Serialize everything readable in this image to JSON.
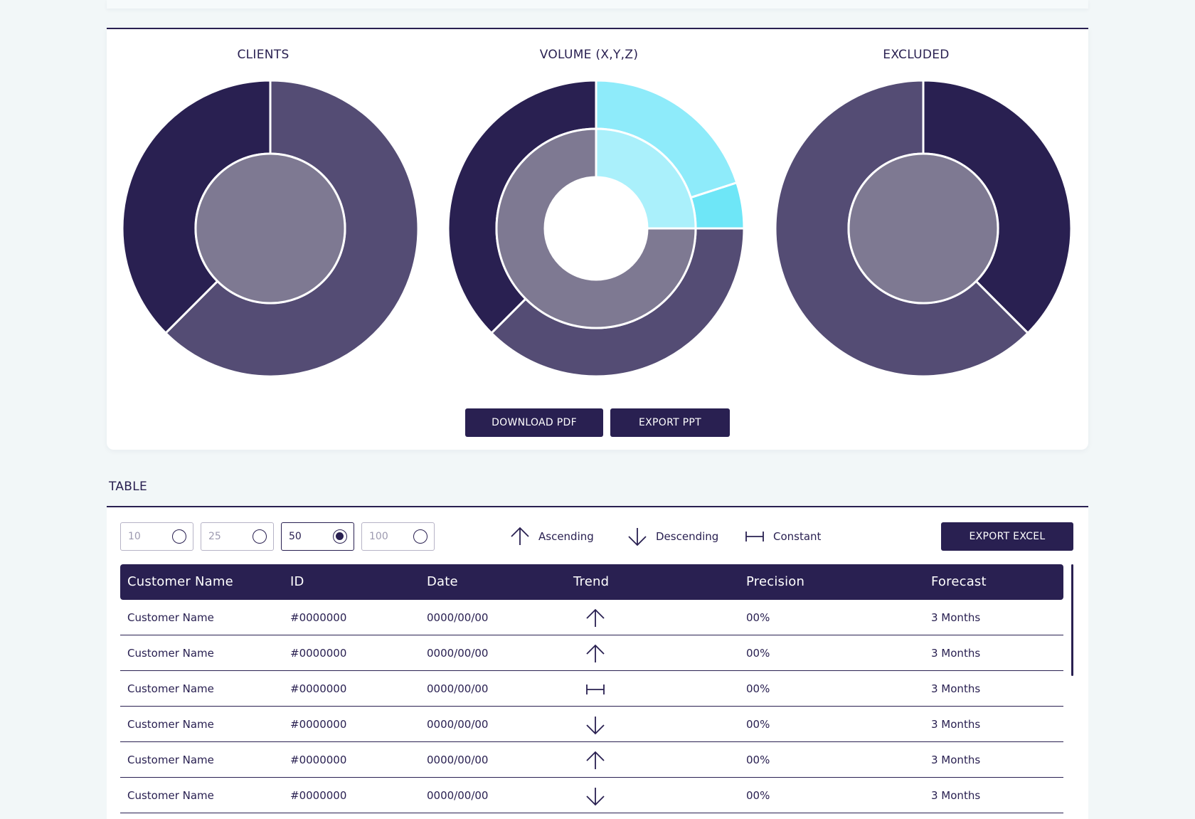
{
  "colors": {
    "navy": "#292051",
    "slate": "#544c74",
    "grey_violet": "#7e7992",
    "cyan_outer": "#8eebfa",
    "cyan_inner": "#aaf0fb",
    "cyan_bright": "#6ee6f7",
    "white": "#ffffff"
  },
  "charts": {
    "title_clients": "CLIENTS",
    "title_volume": "VOLUME (X,Y,Z)",
    "title_excluded": "EXCLUDED"
  },
  "chart_data": [
    {
      "type": "pie",
      "title": "CLIENTS",
      "rings": [
        {
          "ring": "outer",
          "slices": [
            {
              "value": 62.5,
              "color": "#544c74"
            },
            {
              "value": 37.5,
              "color": "#292051"
            }
          ]
        },
        {
          "ring": "inner",
          "slices": [
            {
              "value": 100,
              "color": "#7e7992"
            }
          ]
        }
      ]
    },
    {
      "type": "pie",
      "title": "VOLUME (X,Y,Z)",
      "rings": [
        {
          "ring": "outer",
          "slices": [
            {
              "value": 20,
              "color": "#8eebfa"
            },
            {
              "value": 5,
              "color": "#6ee6f7"
            },
            {
              "value": 37.5,
              "color": "#544c74"
            },
            {
              "value": 37.5,
              "color": "#292051"
            }
          ]
        },
        {
          "ring": "inner",
          "slices": [
            {
              "value": 25,
              "color": "#aaf0fb"
            },
            {
              "value": 75,
              "color": "#7e7992"
            }
          ]
        }
      ]
    },
    {
      "type": "pie",
      "title": "EXCLUDED",
      "rings": [
        {
          "ring": "outer",
          "slices": [
            {
              "value": 37.5,
              "color": "#292051"
            },
            {
              "value": 62.5,
              "color": "#544c74"
            }
          ]
        },
        {
          "ring": "inner",
          "slices": [
            {
              "value": 100,
              "color": "#7e7992"
            }
          ]
        }
      ]
    }
  ],
  "buttons": {
    "download_pdf": "DOWNLOAD PDF",
    "export_ppt": "EXPORT PPT",
    "export_excel": "EXPORT EXCEL"
  },
  "table": {
    "label": "TABLE",
    "page_sizes": [
      "10",
      "25",
      "50",
      "100"
    ],
    "selected_page_size": "50",
    "legend": {
      "ascending": "Ascending",
      "descending": "Descending",
      "constant": "Constant"
    },
    "headers": [
      "Customer Name",
      "ID",
      "Date",
      "Trend",
      "Precision",
      "Forecast"
    ],
    "rows": [
      {
        "name": "Customer Name",
        "id": "#0000000",
        "date": "0000/00/00",
        "trend": "ascending",
        "precision": "00%",
        "forecast": "3 Months"
      },
      {
        "name": "Customer Name",
        "id": "#0000000",
        "date": "0000/00/00",
        "trend": "ascending",
        "precision": "00%",
        "forecast": "3 Months"
      },
      {
        "name": "Customer Name",
        "id": "#0000000",
        "date": "0000/00/00",
        "trend": "constant",
        "precision": "00%",
        "forecast": "3 Months"
      },
      {
        "name": "Customer Name",
        "id": "#0000000",
        "date": "0000/00/00",
        "trend": "descending",
        "precision": "00%",
        "forecast": "3 Months"
      },
      {
        "name": "Customer Name",
        "id": "#0000000",
        "date": "0000/00/00",
        "trend": "ascending",
        "precision": "00%",
        "forecast": "3 Months"
      },
      {
        "name": "Customer Name",
        "id": "#0000000",
        "date": "0000/00/00",
        "trend": "descending",
        "precision": "00%",
        "forecast": "3 Months"
      }
    ]
  }
}
